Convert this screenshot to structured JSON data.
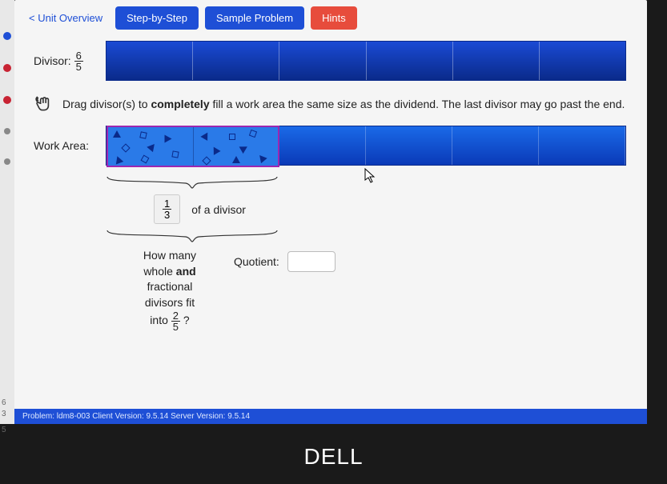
{
  "nav": {
    "back": "< Unit Overview",
    "step": "Step-by-Step",
    "sample": "Sample Problem",
    "hints": "Hints"
  },
  "divisor": {
    "label": "Divisor:",
    "numerator": "6",
    "denominator": "5",
    "segments": 6
  },
  "instruction": {
    "text_pre": "Drag divisor(s) to ",
    "text_bold": "completely",
    "text_post": " fill a work area the same size as the dividend. The last divisor may go past the end."
  },
  "workArea": {
    "label": "Work Area:",
    "segments": 6
  },
  "partial": {
    "fraction_num": "1",
    "fraction_den": "3",
    "of_text": "of a divisor"
  },
  "question": {
    "line1": "How many",
    "line2_pre": "whole ",
    "line2_bold": "and",
    "line3": "fractional",
    "line4": "divisors fit",
    "line5_pre": "into ",
    "frac_num": "2",
    "frac_den": "5",
    "line5_post": " ?"
  },
  "quotient": {
    "label": "Quotient:",
    "value": ""
  },
  "footer": {
    "text": "Problem: ldm8-003   Client Version: 9.5.14   Server Version: 9.5.14"
  },
  "sideNums": {
    "a": "6",
    "b": "3",
    "c": "5"
  },
  "brand": "DELL"
}
